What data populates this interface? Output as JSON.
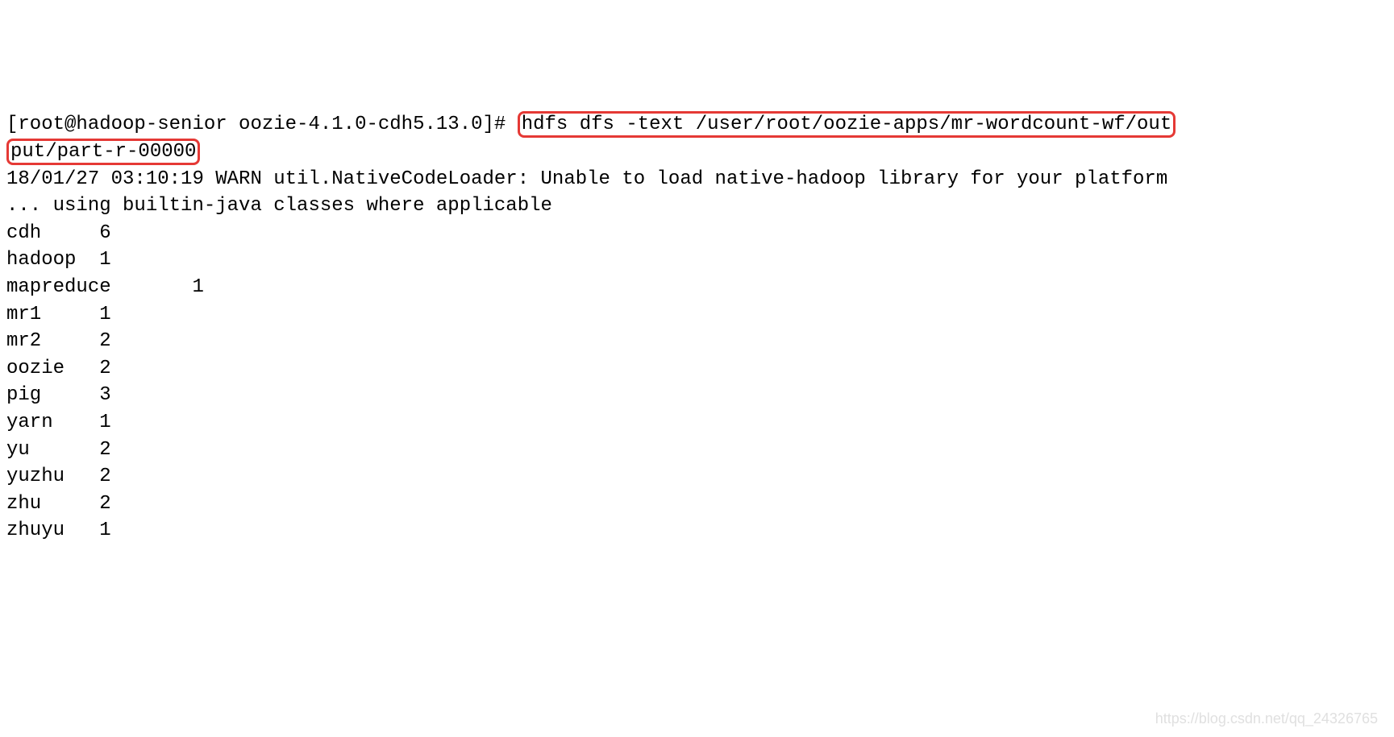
{
  "prompt": "[root@hadoop-senior oozie-4.1.0-cdh5.13.0]# ",
  "command_part1": "hdfs dfs -text /user/root/oozie-apps/mr-wordcount-wf/out",
  "command_part2": "put/part-r-00000",
  "log_line1": "18/01/27 03:10:19 WARN util.NativeCodeLoader: Unable to load native-hadoop library for your platform",
  "log_line2": "... using builtin-java classes where applicable",
  "wordcounts": [
    {
      "word": "cdh",
      "spacing": "     ",
      "count": "6"
    },
    {
      "word": "hadoop",
      "spacing": "  ",
      "count": "1"
    },
    {
      "word": "mapreduce",
      "spacing": "       ",
      "count": "1"
    },
    {
      "word": "mr1",
      "spacing": "     ",
      "count": "1"
    },
    {
      "word": "mr2",
      "spacing": "     ",
      "count": "2"
    },
    {
      "word": "oozie",
      "spacing": "   ",
      "count": "2"
    },
    {
      "word": "pig",
      "spacing": "     ",
      "count": "3"
    },
    {
      "word": "yarn",
      "spacing": "    ",
      "count": "1"
    },
    {
      "word": "yu",
      "spacing": "      ",
      "count": "2"
    },
    {
      "word": "yuzhu",
      "spacing": "   ",
      "count": "2"
    },
    {
      "word": "zhu",
      "spacing": "     ",
      "count": "2"
    },
    {
      "word": "zhuyu",
      "spacing": "   ",
      "count": "1"
    }
  ],
  "watermark": "https://blog.csdn.net/qq_24326765"
}
